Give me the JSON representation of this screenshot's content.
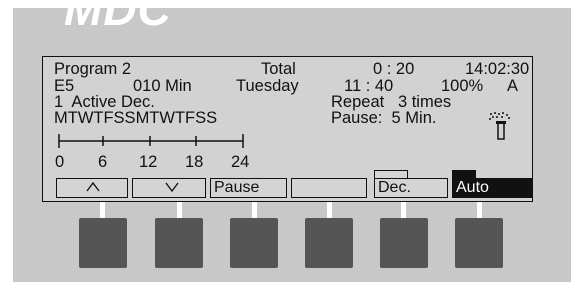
{
  "brand": "MDC",
  "lcd": {
    "row1": {
      "program": "Program 2",
      "total_label": "Total",
      "total_value": "0 : 20",
      "clock": "14:02:30"
    },
    "row2": {
      "station": "E5",
      "duration": "010 Min",
      "day": "Tuesday",
      "time": "11 : 40",
      "percent": "100%",
      "mode_flag": "A"
    },
    "row3": {
      "active": "1  Active Dec.",
      "repeat": "Repeat   3 times"
    },
    "row4": {
      "days": "MTWTFSSMTWTFSS",
      "pause": "Pause:  5 Min."
    },
    "hours": [
      "0",
      "6",
      "12",
      "18",
      "24"
    ],
    "sprinkler_icon": "sprinkler-icon"
  },
  "softkeys": [
    {
      "label": "^",
      "name": "up",
      "inverted": false
    },
    {
      "label": "v",
      "name": "down",
      "inverted": false
    },
    {
      "label": "Pause",
      "name": "pause",
      "inverted": false
    },
    {
      "label": "",
      "name": "blank",
      "inverted": false
    },
    {
      "label": "Dec.",
      "name": "dec",
      "inverted": false
    },
    {
      "label": "Auto",
      "name": "auto",
      "inverted": true
    }
  ],
  "colors": {
    "lcd_background": "#d2d2d2",
    "button": "#555555",
    "frame": "#c8c8c8"
  }
}
